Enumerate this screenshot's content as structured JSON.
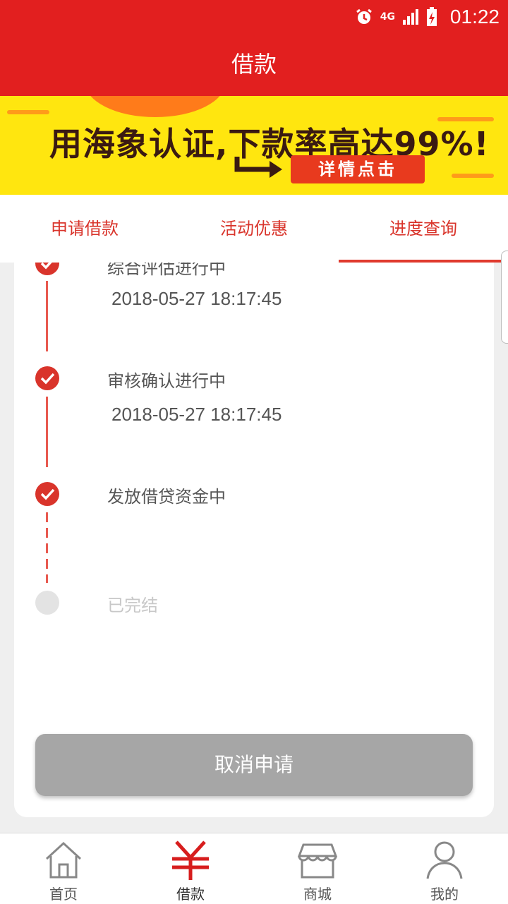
{
  "status_bar": {
    "time": "01:22",
    "network": "4G"
  },
  "header": {
    "title": "借款"
  },
  "banner": {
    "headline": "用海象认证,下款率高达99%!",
    "cta": "详情点击"
  },
  "tabs": [
    {
      "label": "申请借款",
      "active": false
    },
    {
      "label": "活动优惠",
      "active": false
    },
    {
      "label": "进度查询",
      "active": true
    }
  ],
  "steps": [
    {
      "title": "综合评估进行中",
      "time": "2018-05-27 18:17:45",
      "done": true
    },
    {
      "title": "审核确认进行中",
      "time": "2018-05-27 18:17:45",
      "done": true
    },
    {
      "title": "发放借贷资金中",
      "time": "",
      "done": true
    },
    {
      "title": "已完结",
      "time": "",
      "done": false
    }
  ],
  "cancel_button": "取消申请",
  "bottom_nav": [
    {
      "label": "首页",
      "icon": "home-icon",
      "active": false
    },
    {
      "label": "借款",
      "icon": "yen-icon",
      "active": true
    },
    {
      "label": "商城",
      "icon": "store-icon",
      "active": false
    },
    {
      "label": "我的",
      "icon": "user-icon",
      "active": false
    }
  ],
  "colors": {
    "brand_red": "#e21f1f",
    "banner_yellow": "#ffe60f",
    "disabled_gray": "#a6a6a6"
  }
}
